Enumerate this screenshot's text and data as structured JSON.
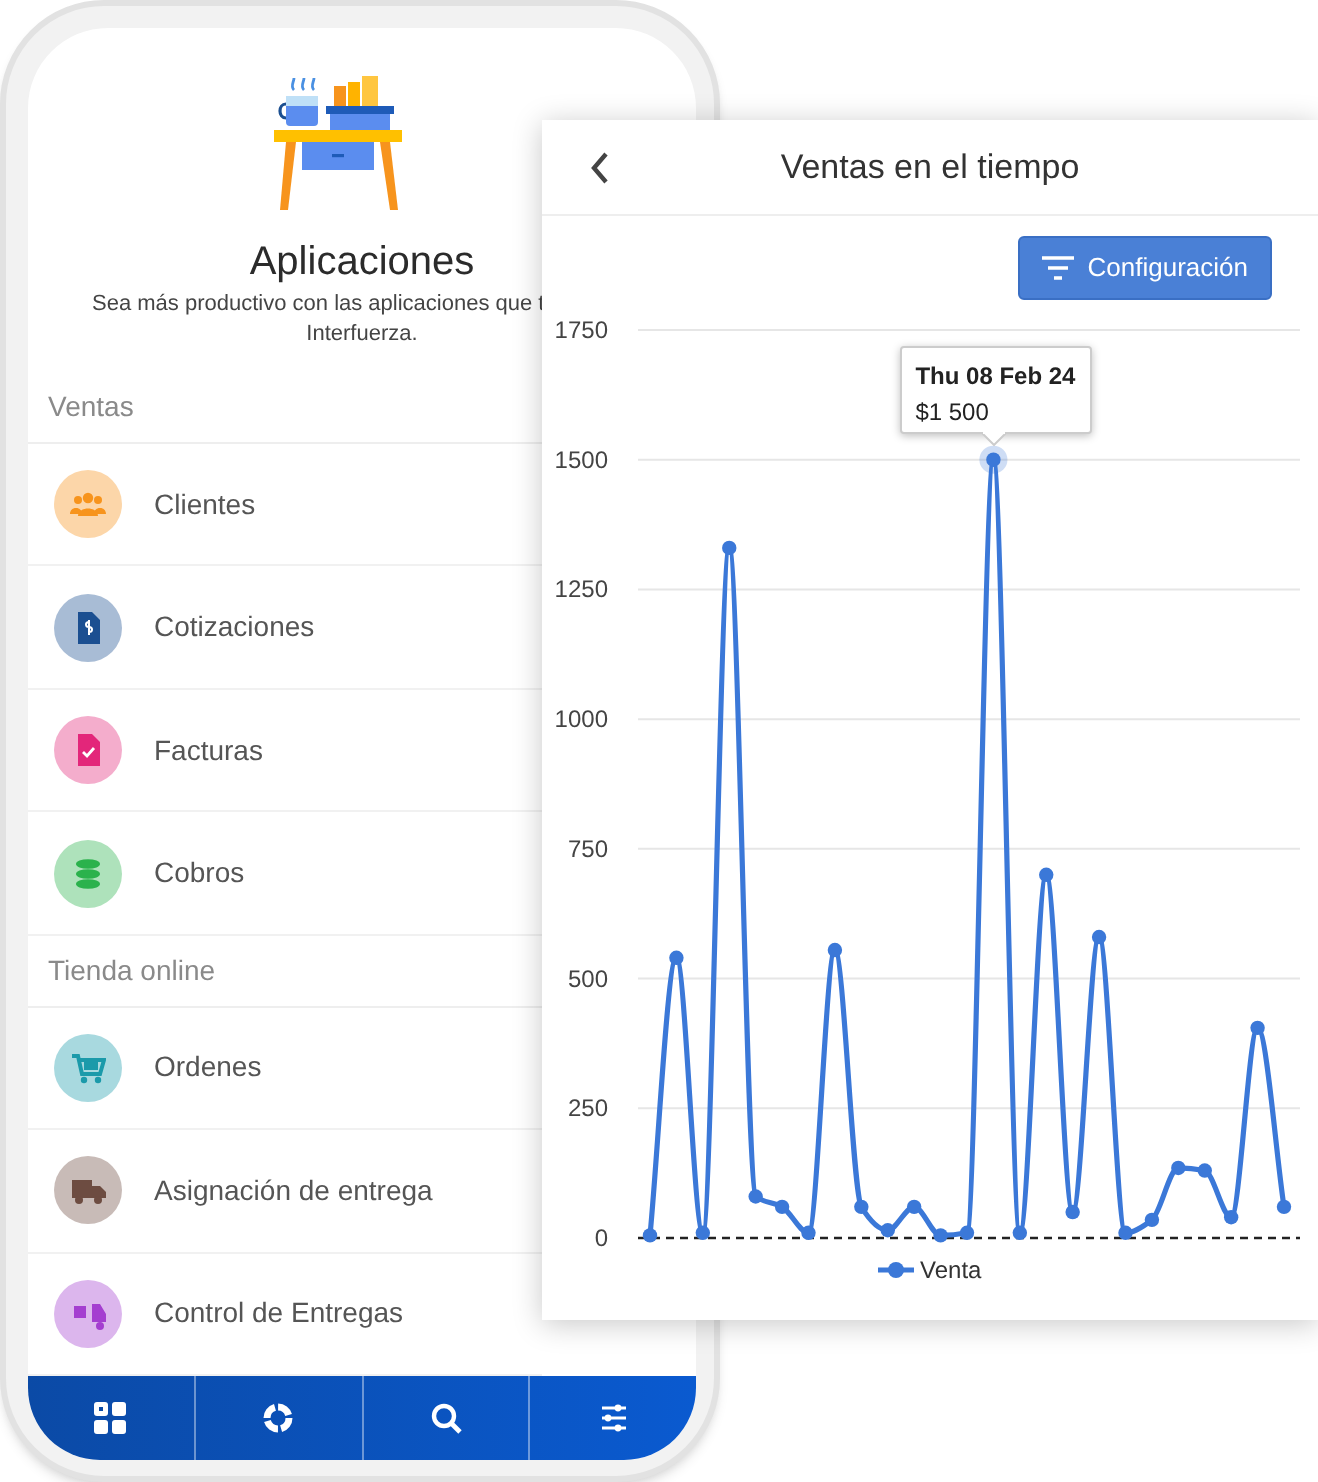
{
  "app": {
    "title": "Aplicaciones",
    "subtitle_line_1": "Sea más productivo con las aplicaciones que t",
    "subtitle_line_2": "Interfuerza."
  },
  "sections": [
    {
      "title": "Ventas",
      "items": [
        {
          "label": "Clientes",
          "color": "#f7941d"
        },
        {
          "label": "Cotizaciones",
          "color": "#1b4f91"
        },
        {
          "label": "Facturas",
          "color": "#e3267a"
        },
        {
          "label": "Cobros",
          "color": "#2bb24c"
        }
      ]
    },
    {
      "title": "Tienda online",
      "items": [
        {
          "label": "Ordenes",
          "color": "#1b9aaa"
        },
        {
          "label": "Asignación de entrega",
          "color": "#6d4c41"
        },
        {
          "label": "Control de Entregas",
          "color": "#a43ed0"
        }
      ]
    }
  ],
  "bottom_nav": [
    {
      "kind": "grid"
    },
    {
      "kind": "chart"
    },
    {
      "kind": "search"
    },
    {
      "kind": "sliders"
    }
  ],
  "chart_panel": {
    "title": "Ventas en el tiempo",
    "button": "Configuración",
    "tooltip": {
      "date": "Thu 08 Feb 24",
      "value": "$1 500"
    },
    "chart_data": {
      "type": "line",
      "grid": true,
      "series": [
        {
          "name": "Venta",
          "color": "#3b78d8",
          "marker": "circle",
          "values": [
            5,
            540,
            10,
            1330,
            80,
            60,
            10,
            555,
            60,
            15,
            60,
            5,
            10,
            1500,
            10,
            700,
            50,
            580,
            10,
            35,
            135,
            130,
            40,
            405,
            60
          ]
        }
      ],
      "ylim": [
        0,
        1750
      ],
      "yticks": [
        0,
        250,
        500,
        750,
        1000,
        1250,
        1500,
        1750
      ]
    }
  }
}
